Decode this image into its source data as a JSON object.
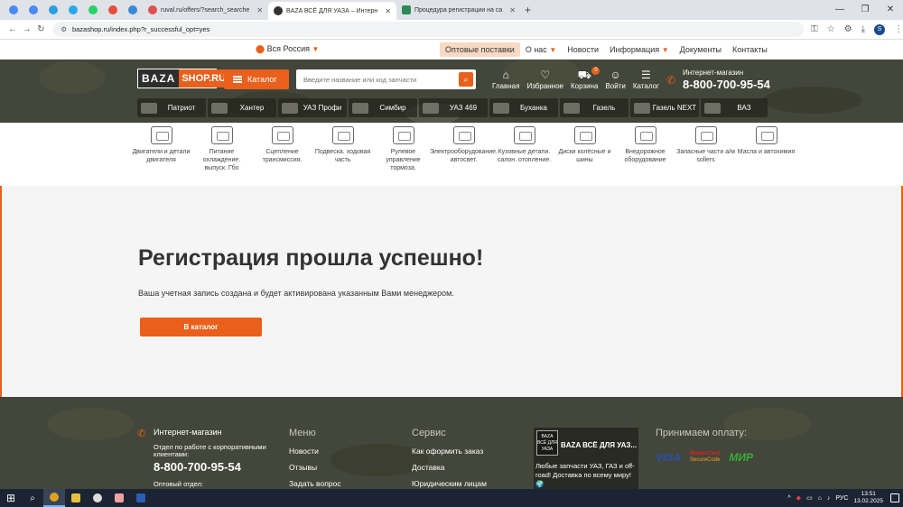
{
  "browser": {
    "pinned_tab_colors": [
      "#4a8af4",
      "#4a8af4",
      "#2aa0e0",
      "#29a8e8",
      "#25d366",
      "#e74c3c",
      "#3a88d8"
    ],
    "tabs": [
      {
        "title": "ruval.ru/offers/?search_searche",
        "icon_color": "#e05050"
      },
      {
        "title": "BAZA ВСЁ ДЛЯ УАЗА – Интерн",
        "icon_color": "#333333",
        "active": true
      },
      {
        "title": "Процедура регистрации на са",
        "icon_color": "#2e8b57"
      }
    ],
    "url": "bazashop.ru/index.php?r_successful_opt=yes",
    "profile_initial": "S"
  },
  "topnav": {
    "region": "Вся Россия",
    "menu": [
      "Оптовые поставки",
      "О нас",
      "Новости",
      "Информация",
      "Документы",
      "Контакты"
    ]
  },
  "header": {
    "logo_left": "BAZA",
    "logo_right": "SHOP.RU",
    "catalog_button": "Каталог",
    "search_placeholder": "Введите название или код запчасти",
    "icons": [
      {
        "label": "Главная",
        "glyph": "⌂"
      },
      {
        "label": "Избранное",
        "glyph": "♡"
      },
      {
        "label": "Корзина",
        "glyph": "⛟",
        "badge": "0"
      },
      {
        "label": "Войти",
        "glyph": "☺"
      },
      {
        "label": "Каталог",
        "glyph": "☰"
      }
    ],
    "phone_caption": "Интернет-магазин",
    "phone": "8-800-700-95-54",
    "models": [
      "Патриот",
      "Хантер",
      "УАЗ Профи",
      "Симбир",
      "УАЗ 469",
      "Буханка",
      "Газель",
      "Газель NEXT",
      "ВАЗ"
    ]
  },
  "categories": [
    {
      "label": "Двигатели и детали двигателя"
    },
    {
      "label": "Питание охлаждение. выпуск. Гбо"
    },
    {
      "label": "Сцепление трансмиссия."
    },
    {
      "label": "Подвеска. ходовая часть"
    },
    {
      "label": "Рулевое управление тормоза."
    },
    {
      "label": "Электрооборудование. автосвет."
    },
    {
      "label": "Кузовные детали. салон. отопление."
    },
    {
      "label": "Диски колёсные и шины"
    },
    {
      "label": "Внедорожное оборудование"
    },
    {
      "label": "Запасные части а/м sollers"
    },
    {
      "label": "Масла и автохимия"
    }
  ],
  "main": {
    "title": "Регистрация прошла успешно!",
    "message": "Ваша учетная запись создана и будет активирована указанным Вами менеджером.",
    "cta": "В каталог"
  },
  "footer": {
    "shop_title": "Интернет-магазин",
    "shop_desc": "Отдел по работе с корпоративными клиентами:",
    "shop_phone": "8-800-700-95-54",
    "shop_retail": "Оптовый отдел:",
    "menu_title": "Меню",
    "menu_items": [
      "Новости",
      "Отзывы",
      "Задать вопрос"
    ],
    "service_title": "Сервис",
    "service_items": [
      "Как оформить заказ",
      "Доставка",
      "Юридическим лицам"
    ],
    "promo_logo": "BAZA ВСЁ ДЛЯ УАЗА",
    "promo_title": "BAZA ВСЁ ДЛЯ УАЗ...",
    "promo_text": "Любые запчасти УАЗ, ГАЗ и off-roadǃ Доставка по всему мируǃ 🌍",
    "pay_title": "Принимаем оплату:",
    "pay_visa": "VISA",
    "pay_mc1": "MasterCard",
    "pay_mc2": "SecureCode",
    "pay_mir": "МИР"
  },
  "taskbar": {
    "lang": "РУС",
    "time": "13:51",
    "date": "13.02.2025"
  }
}
